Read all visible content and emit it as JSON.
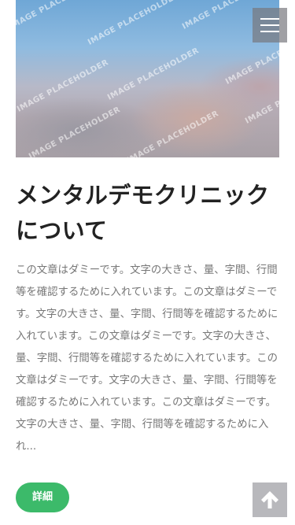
{
  "hero": {
    "watermark_text": "IMAGE PLACEHOLDER",
    "icon": "camera-icon"
  },
  "header": {
    "menu_icon": "hamburger-menu-icon"
  },
  "article": {
    "title_line1": "メンタルデモクリニック",
    "title_line2": "について",
    "body": "この文章はダミーです。文字の大きさ、量、字間、行間等を確認するために入れています。この文章はダミーです。文字の大きさ、量、字間、行間等を確認するために入れています。この文章はダミーです。文字の大きさ、量、字間、行間等を確認するために入れています。この文章はダミーです。文字の大きさ、量、字間、行間等を確認するために入れています。この文章はダミーです。文字の大きさ、量、字間、行間等を確認するために入れ..."
  },
  "detail_button": {
    "label": "詳細"
  },
  "back_to_top": {
    "icon": "arrow-up-icon"
  },
  "colors": {
    "accent_green": "#3cba6a",
    "title": "#222222",
    "body_text": "#777777"
  }
}
